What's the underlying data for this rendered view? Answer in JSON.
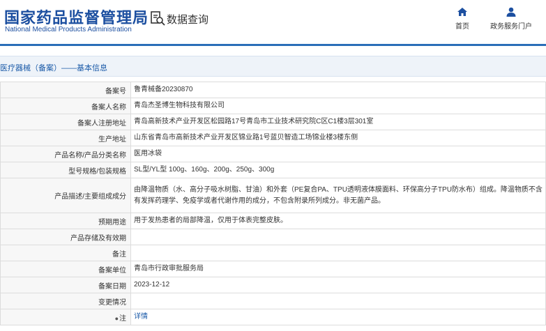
{
  "header": {
    "logo_cn": "国家药品监督管理局",
    "logo_en": "National Medical Products Administration",
    "query_label": "数据查询",
    "nav": [
      {
        "label": "首页",
        "icon": "home-icon"
      },
      {
        "label": "政务服务门户",
        "icon": "user-icon"
      }
    ]
  },
  "section": {
    "title": "医疗器械（备案）——基本信息"
  },
  "rows": [
    {
      "key": "备案号",
      "value": "鲁青械备20230870"
    },
    {
      "key": "备案人名称",
      "value": "青岛杰圣博生物科技有限公司"
    },
    {
      "key": "备案人注册地址",
      "value": "青岛高新技术产业开发区松园路17号青岛市工业技术研究院C区C1楼3层301室"
    },
    {
      "key": "生产地址",
      "value": "山东省青岛市高新技术产业开发区锦业路1号蓝贝智造工场锦业楼3楼东侧"
    },
    {
      "key": "产品名称/产品分类名称",
      "value": "医用冰袋"
    },
    {
      "key": "型号规格/包装规格",
      "value": "SL型/YL型 100g、160g、200g、250g、300g"
    },
    {
      "key": "产品描述/主要组成成分",
      "value": "由降温物质（水、高分子吸水树脂、甘油）和外套（PE复合PA、TPU透明液体膜面料、环保高分子TPU防水布）组成。降温物质不含有发挥药理学、免疫学或者代谢作用的成分，不包含附录所列成分。非无菌产品。"
    },
    {
      "key": "预期用途",
      "value": "用于发热患者的局部降温，仅用于体表完整皮肤。"
    },
    {
      "key": "产品存储及有效期",
      "value": ""
    },
    {
      "key": "备注",
      "value": ""
    },
    {
      "key": "备案单位",
      "value": "青岛市行政审批服务局"
    },
    {
      "key": "备案日期",
      "value": "2023-12-12"
    },
    {
      "key": "变更情况",
      "value": ""
    },
    {
      "key": "注",
      "value": "详情"
    }
  ],
  "colors": {
    "brand": "#1c4fa0",
    "accent": "#2a6eb8",
    "link": "#1a5aa8"
  }
}
